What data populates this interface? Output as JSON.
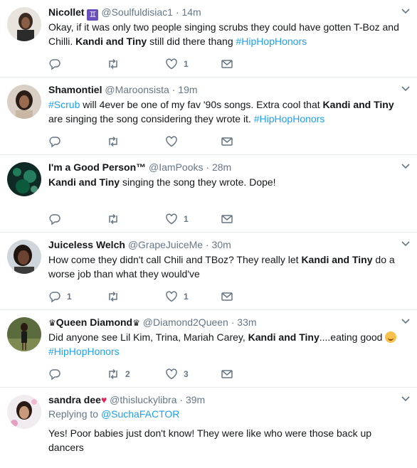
{
  "colors": {
    "accent": "#1da1f2",
    "muted": "#657786",
    "text": "#14171a",
    "divider": "#e6ecf0"
  },
  "tweets": [
    {
      "name": "Nicollet",
      "name_badge": "♊",
      "handle": "@Soulfuldisiac1",
      "time": "14m",
      "avatar_icon": "user-avatar",
      "text_parts": [
        "Okay, if it was only two people singing scrubs they could have gotten T-Boz and Chilli. ",
        "Kandi and Tiny",
        " still did there thang ",
        "#HipHopHonors"
      ],
      "reply_count": "",
      "retweet_count": "",
      "like_count": "1"
    },
    {
      "name": "Shamontiel",
      "handle": "@Maroonsista",
      "time": "19m",
      "avatar_icon": "user-avatar",
      "text_parts": [
        "#Scrub",
        " will 4ever be one of my fav '90s songs. Extra cool that ",
        "Kandi and Tiny",
        " are singing the song considering they wrote it. ",
        "#HipHopHonors"
      ],
      "reply_count": "",
      "retweet_count": "",
      "like_count": ""
    },
    {
      "name": "I'm a Good Person™",
      "handle": "@IamPooks",
      "time": "28m",
      "avatar_icon": "user-avatar",
      "text_parts": [
        "Kandi and Tiny",
        " singing the song they wrote. Dope!"
      ],
      "reply_count": "",
      "retweet_count": "",
      "like_count": "1"
    },
    {
      "name": "Juiceless Welch",
      "handle": "@GrapeJuiceMe",
      "time": "30m",
      "avatar_icon": "user-avatar",
      "text_parts": [
        "How come they didn't call Chili and TBoz? They really let ",
        "Kandi and Tiny",
        " do a worse job than what they would've"
      ],
      "reply_count": "1",
      "retweet_count": "",
      "like_count": "1"
    },
    {
      "name_prefix": "♛",
      "name": "Queen Diamond",
      "name_suffix": "♛",
      "handle": "@Diamond2Queen",
      "time": "33m",
      "avatar_icon": "user-avatar",
      "text_parts": [
        "Did anyone see Lil Kim, Trina, Mariah Carey, ",
        "Kandi and Tiny",
        "....eating good ",
        "#HipHopHonors"
      ],
      "reply_count": "",
      "retweet_count": "2",
      "like_count": "3"
    },
    {
      "name": "sandra dee",
      "name_emoji": "♥",
      "handle": "@thisluckylibra",
      "time": "39m",
      "avatar_icon": "user-avatar",
      "replying_label": "Replying to ",
      "replying_to": "@SuchaFACTOR",
      "text_parts": [
        "Yes! Poor babies just don't know! They were like who were those back up dancers"
      ]
    }
  ]
}
